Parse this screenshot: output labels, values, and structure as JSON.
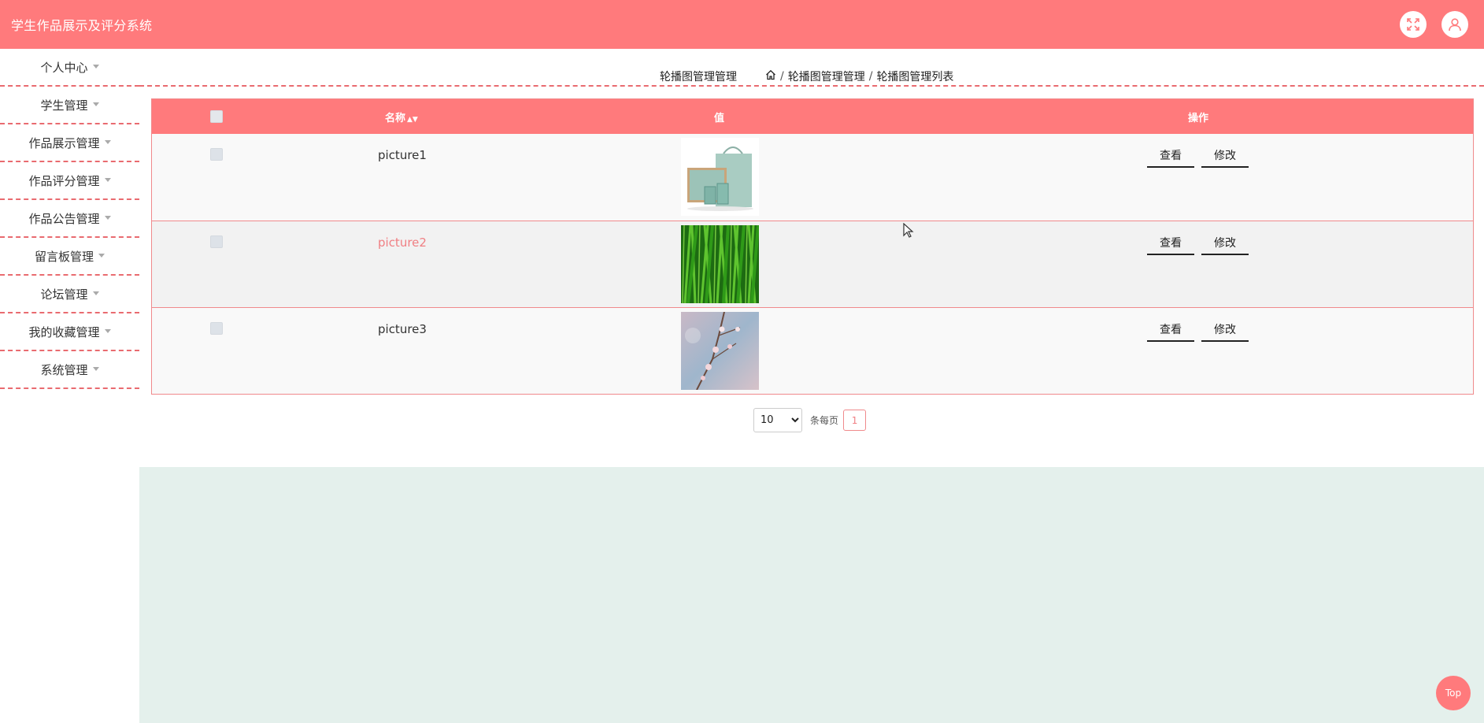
{
  "app": {
    "title": "学生作品展示及评分系统"
  },
  "header": {
    "fullscreen_icon": "fullscreen-icon",
    "user_icon": "user-icon"
  },
  "sidebar": {
    "items": [
      {
        "label": "个人中心"
      },
      {
        "label": "学生管理"
      },
      {
        "label": "作品展示管理"
      },
      {
        "label": "作品评分管理"
      },
      {
        "label": "作品公告管理"
      },
      {
        "label": "留言板管理"
      },
      {
        "label": "论坛管理"
      },
      {
        "label": "我的收藏管理"
      },
      {
        "label": "系统管理"
      }
    ]
  },
  "breadcrumb": {
    "page_title": "轮播图管理管理",
    "home_icon": "home-icon",
    "separator": "/",
    "level1": "轮播图管理管理",
    "level2": "轮播图管理列表"
  },
  "table": {
    "columns": {
      "name": "名称",
      "value": "值",
      "actions": "操作"
    },
    "rows": [
      {
        "name": "picture1",
        "image": "gift-box-thumbnail",
        "view": "查看",
        "edit": "修改"
      },
      {
        "name": "picture2",
        "image": "green-grass-thumbnail",
        "view": "查看",
        "edit": "修改"
      },
      {
        "name": "picture3",
        "image": "blossom-branch-thumbnail",
        "view": "查看",
        "edit": "修改"
      }
    ]
  },
  "pagination": {
    "page_size": "10",
    "page_size_options": [
      "10"
    ],
    "per_page_label": "条每页",
    "current_page": "1"
  },
  "back_to_top": {
    "label": "Top"
  },
  "colors": {
    "primary": "#ff7a7c",
    "divider": "#e96b70",
    "active_text": "#f07f83",
    "bottom_panel": "#e4f0ec"
  }
}
